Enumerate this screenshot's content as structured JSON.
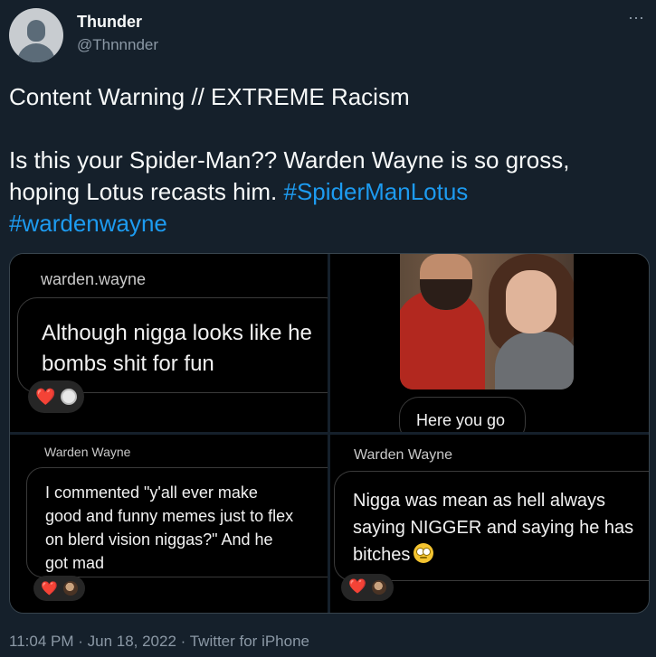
{
  "author": {
    "name": "Thunder",
    "handle": "@Thnnnder"
  },
  "more_icon": "⋯",
  "tweet": {
    "line1": "Content Warning // EXTREME Racism",
    "line2": "Is this your Spider-Man?? Warden Wayne is so gross,",
    "line3_text": "hoping Lotus recasts him. ",
    "hashtag1": "#SpiderManLotus",
    "hashtag2": "#wardenwayne"
  },
  "media": {
    "c1": {
      "user": "warden.wayne",
      "message": "Although nigga looks like he\nbombs shit for fun",
      "reaction": "❤️"
    },
    "c2": {
      "reply": "Here you go"
    },
    "c3": {
      "user": "Warden Wayne",
      "message": "I commented \"y'all ever make\ngood and funny memes just to flex\non blerd vision niggas?\" And he\ngot mad",
      "reaction": "❤️"
    },
    "c4": {
      "user": "Warden Wayne",
      "message": "Nigga was mean as hell always\nsaying NIGGER and saying he has\nbitches",
      "reaction": "❤️"
    }
  },
  "footer": {
    "timestamp": "11:04 PM · Jun 18, 2022 · Twitter for iPhone"
  },
  "colors": {
    "background": "#15202b",
    "hashtag": "#1d9bf0",
    "muted": "#8b98a5"
  }
}
